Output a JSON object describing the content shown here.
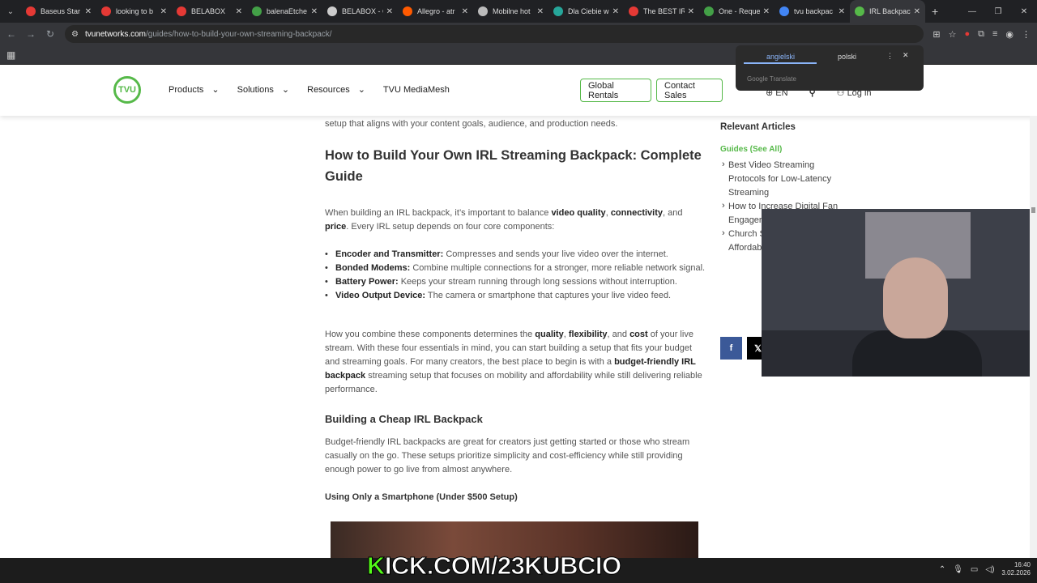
{
  "browser": {
    "tabs": [
      {
        "label": "Baseus Star",
        "color": "#e53935"
      },
      {
        "label": "looking to b",
        "color": "#e53935"
      },
      {
        "label": "BELABOX",
        "color": "#e53935"
      },
      {
        "label": "balenaEtche",
        "color": "#43a047"
      },
      {
        "label": "BELABOX - G",
        "color": "#cccccc"
      },
      {
        "label": "Allegro - atr",
        "color": "#ff5a00"
      },
      {
        "label": "Mobilne hot",
        "color": "#bbbbbb"
      },
      {
        "label": "Dla Ciebie w",
        "color": "#26a69a"
      },
      {
        "label": "The BEST IR",
        "color": "#e53935"
      },
      {
        "label": "One - Reque",
        "color": "#43a047"
      },
      {
        "label": "tvu backpac",
        "color": "#4285f4"
      },
      {
        "label": "IRL Backpack",
        "color": "#56b949"
      }
    ],
    "url_site": "tvunetworks.com",
    "url_path": "/guides/how-to-build-your-own-streaming-backpack/"
  },
  "translate": {
    "lang_from": "angielski",
    "lang_to": "polski",
    "provider": "Google Translate"
  },
  "header": {
    "logo_text": "TVU",
    "menu": [
      "Products",
      "Solutions",
      "Resources",
      "TVU MediaMesh"
    ],
    "btn_rentals": "Global Rentals",
    "btn_contact": "Contact Sales",
    "lang": "EN",
    "login": "Log in"
  },
  "article": {
    "lead": "setup that aligns with your content goals, audience, and production needs.",
    "h1": "How to Build Your Own IRL Streaming Backpack: Complete Guide",
    "p1_a": "When building an IRL backpack, it’s important to balance ",
    "p1_b1": "video quality",
    "p1_sep1": ", ",
    "p1_b2": "connectivity",
    "p1_sep2": ", and ",
    "p1_b3": "price",
    "p1_c": ". Every IRL setup depends on four core components:",
    "bullets": [
      {
        "term": "Encoder and Transmitter:",
        "text": " Compresses and sends your live video over the internet."
      },
      {
        "term": "Bonded Modems:",
        "text": " Combine multiple connections for a stronger, more reliable network signal."
      },
      {
        "term": "Battery Power:",
        "text": " Keeps your stream running through long sessions without interruption."
      },
      {
        "term": "Video Output Device:",
        "text": " The camera or smartphone that captures your live video feed."
      }
    ],
    "p2_a": "How you combine these components determines the ",
    "p2_b1": "quality",
    "p2_s1": ", ",
    "p2_b2": "flexibility",
    "p2_s2": ", and ",
    "p2_b3": "cost",
    "p2_c": " of your live stream. With these four essentials in mind, you can start building a setup that fits your budget and streaming goals. For many creators, the best place to begin is with a ",
    "p2_b4": "budget-friendly IRL backpack",
    "p2_d": " streaming setup that focuses on mobility and affordability while still delivering reliable performance.",
    "h2": "Building a Cheap IRL Backpack",
    "p3": "Budget-friendly IRL backpacks are great for creators just getting started or those who stream casually on the go. These setups prioritize simplicity and cost-efficiency while still providing enough power to go live from almost anywhere.",
    "h3": "Using Only a Smartphone (Under $500 Setup)"
  },
  "sidebar": {
    "title": "Relevant Articles",
    "see_all": "Guides (See All)",
    "items": [
      "Best Video Streaming Protocols for Low-Latency Streaming",
      "How to Increase Digital Fan Engager Technolo Results",
      "Church Setup G What Yo Affordab Ministry"
    ]
  },
  "share": {
    "facebook": "f",
    "x": "𝕏"
  },
  "overlay": {
    "kick_k": "K",
    "kick_rest": "ICK.COM/23KUBCIO"
  },
  "tray": {
    "time": "16:40",
    "date": "3.02.2026"
  }
}
